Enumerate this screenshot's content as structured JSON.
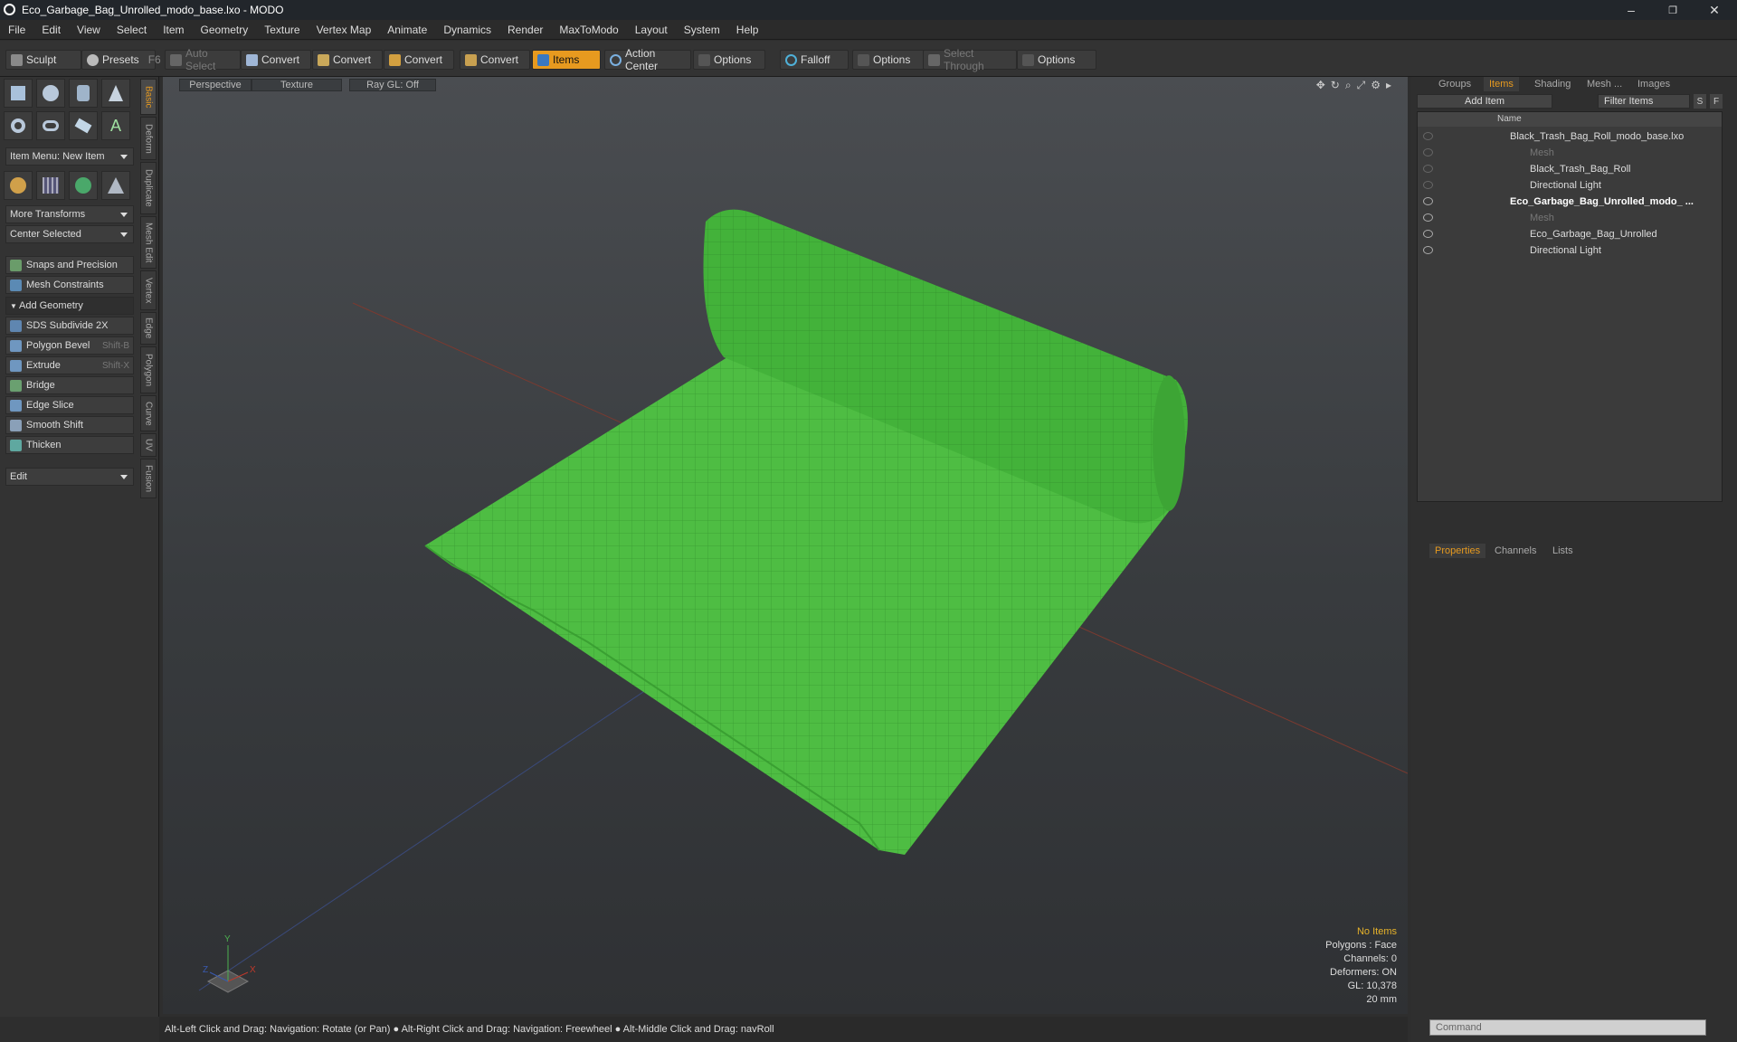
{
  "window": {
    "title": "Eco_Garbage_Bag_Unrolled_modo_base.lxo - MODO",
    "min": "–",
    "max": "❐",
    "close": "✕"
  },
  "menu": [
    "File",
    "Edit",
    "View",
    "Select",
    "Item",
    "Geometry",
    "Texture",
    "Vertex Map",
    "Animate",
    "Dynamics",
    "Render",
    "MaxToModo",
    "Layout",
    "System",
    "Help"
  ],
  "toolbar": {
    "sculpt": "Sculpt",
    "presets": "Presets",
    "presets_key": "F6",
    "auto_select": "Auto Select",
    "convert1": "Convert",
    "convert2": "Convert",
    "convert3": "Convert",
    "convert4": "Convert",
    "items": "Items",
    "action_center": "Action Center",
    "options1": "Options",
    "falloff": "Falloff",
    "options2": "Options",
    "select_through": "Select Through",
    "options3": "Options"
  },
  "left": {
    "item_menu": "Item Menu: New Item",
    "more_transforms": "More Transforms",
    "center_selected": "Center Selected",
    "snaps": "Snaps and Precision",
    "mesh_constraints": "Mesh Constraints",
    "add_geometry": "Add Geometry",
    "sds": "SDS Subdivide 2X",
    "polygon_bevel": "Polygon Bevel",
    "polygon_bevel_key": "Shift-B",
    "extrude": "Extrude",
    "extrude_key": "Shift-X",
    "bridge": "Bridge",
    "edge_slice": "Edge Slice",
    "smooth_shift": "Smooth Shift",
    "thicken": "Thicken",
    "edit": "Edit"
  },
  "vtabs": [
    "Basic",
    "Deform",
    "Duplicate",
    "Mesh Edit",
    "Vertex",
    "Edge",
    "Polygon",
    "Curve",
    "UV",
    "Fusion"
  ],
  "viewport": {
    "perspective": "Perspective",
    "texture": "Texture",
    "raygl": "Ray GL: Off",
    "stats": {
      "items": "No Items",
      "polygons": "Polygons : Face",
      "channels": "Channels: 0",
      "deformers": "Deformers: ON",
      "gl": "GL: 10,378",
      "scale": "20 mm"
    },
    "axis_y": "Y",
    "axis_x": "X",
    "axis_z": "Z"
  },
  "status": "Alt-Left Click and Drag: Navigation: Rotate (or Pan) ● Alt-Right Click and Drag: Navigation: Freewheel ● Alt-Middle Click and Drag: navRoll",
  "right": {
    "tabs": [
      "Groups",
      "Items",
      "Shading",
      "Mesh ...",
      "Images"
    ],
    "add_item": "Add Item",
    "filter": "Filter Items",
    "s": "S",
    "f": "F",
    "col_name": "Name",
    "tree": [
      "Black_Trash_Bag_Roll_modo_base.lxo",
      "Mesh",
      "Black_Trash_Bag_Roll",
      "Directional Light",
      "Eco_Garbage_Bag_Unrolled_modo_ ...",
      "Mesh",
      "Eco_Garbage_Bag_Unrolled",
      "Directional Light"
    ],
    "ptabs": [
      "Properties",
      "Channels",
      "Lists"
    ],
    "command": "Command"
  }
}
